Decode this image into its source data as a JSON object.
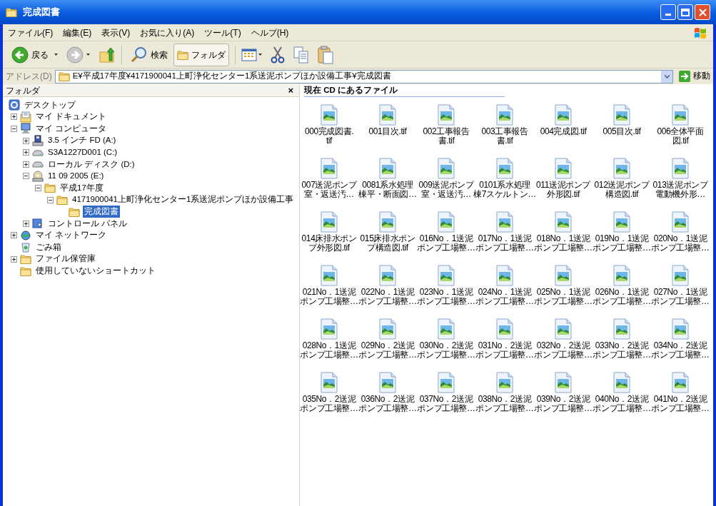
{
  "window": {
    "title": "完成図書"
  },
  "menu": [
    "ファイル(F)",
    "編集(E)",
    "表示(V)",
    "お気に入り(A)",
    "ツール(T)",
    "ヘルプ(H)"
  ],
  "toolbar": {
    "back": "戻る",
    "search": "検索",
    "folders": {
      "label": "フォルダ",
      "selected": true
    }
  },
  "address": {
    "label": "アドレス(D)",
    "value": "E¥平成17年度¥4171900041上町浄化センター1系送泥ポンプほか設備工事¥完成図書",
    "go": "移動"
  },
  "folder_pane": {
    "title": "フォルダ",
    "close": "×",
    "tree": [
      {
        "label": "デスクトップ",
        "kind": "desktop",
        "selected": false,
        "children": [
          {
            "label": "マイ ドキュメント",
            "kind": "documents",
            "expanded": false,
            "selected": false
          },
          {
            "label": "マイ コンピュータ",
            "kind": "computer",
            "expanded": true,
            "selected": false,
            "children": [
              {
                "label": "3.5 インチ FD (A:)",
                "kind": "floppy",
                "expanded": false,
                "selected": false
              },
              {
                "label": "S3A1227D001 (C:)",
                "kind": "drive",
                "expanded": false,
                "selected": false
              },
              {
                "label": "ローカル ディスク (D:)",
                "kind": "drive",
                "expanded": false,
                "selected": false
              },
              {
                "label": "11 09 2005 (E:)",
                "kind": "cd",
                "expanded": true,
                "selected": false,
                "children": [
                  {
                    "label": "平成17年度",
                    "kind": "folder",
                    "expanded": true,
                    "selected": false,
                    "children": [
                      {
                        "label": "4171900041上町浄化センター1系送泥ポンプほか設備工事",
                        "kind": "folder",
                        "expanded": true,
                        "selected": false,
                        "children": [
                          {
                            "label": "完成図書",
                            "kind": "folder",
                            "selected": true
                          }
                        ]
                      }
                    ]
                  }
                ]
              },
              {
                "label": "コントロール パネル",
                "kind": "control-panel",
                "expanded": false,
                "selected": false
              }
            ]
          },
          {
            "label": "マイ ネットワーク",
            "kind": "network",
            "expanded": false,
            "selected": false
          },
          {
            "label": "ごみ箱",
            "kind": "recycle-bin",
            "selected": false
          },
          {
            "label": "ファイル保管庫",
            "kind": "folder",
            "expanded": false,
            "selected": false
          },
          {
            "label": "使用していないショートカット",
            "kind": "folder",
            "selected": false
          }
        ]
      }
    ]
  },
  "file_pane": {
    "heading": "現在 CD にあるファイル",
    "files": [
      {
        "lines": [
          "000完成図書.",
          "tif"
        ]
      },
      {
        "lines": [
          "001目次.tif"
        ]
      },
      {
        "lines": [
          "002工事報告",
          "書.tif"
        ]
      },
      {
        "lines": [
          "003工事報告",
          "書.tif"
        ]
      },
      {
        "lines": [
          "004完成図.tif"
        ]
      },
      {
        "lines": [
          "005目次.tif"
        ]
      },
      {
        "lines": [
          "006全体平面",
          "図.tif"
        ]
      },
      {
        "lines": [
          "007送泥ポンプ",
          "室・返送汚…"
        ]
      },
      {
        "lines": [
          "0081系水処理",
          "棟平・断面図…"
        ]
      },
      {
        "lines": [
          "009送泥ポンプ",
          "室・返送汚…"
        ]
      },
      {
        "lines": [
          "0101系水処理",
          "棟7スケルトン…"
        ]
      },
      {
        "lines": [
          "011送泥ポンプ",
          "外形図.tif"
        ]
      },
      {
        "lines": [
          "012送泥ポンプ",
          "構造図.tif"
        ]
      },
      {
        "lines": [
          "013送泥ポンプ",
          "電動機外形…"
        ]
      },
      {
        "lines": [
          "014床排水ポン",
          "プ外形図.tif"
        ]
      },
      {
        "lines": [
          "015床排水ポン",
          "プ構造図.tif"
        ]
      },
      {
        "lines": [
          "016No．1送泥",
          "ポンプ工場整…"
        ]
      },
      {
        "lines": [
          "017No．1送泥",
          "ポンプ工場整…"
        ]
      },
      {
        "lines": [
          "018No．1送泥",
          "ポンプ工場整…"
        ]
      },
      {
        "lines": [
          "019No．1送泥",
          "ポンプ工場整…"
        ]
      },
      {
        "lines": [
          "020No．1送泥",
          "ポンプ工場整…"
        ]
      },
      {
        "lines": [
          "021No．1送泥",
          "ポンプ工場整…"
        ]
      },
      {
        "lines": [
          "022No．1送泥",
          "ポンプ工場整…"
        ]
      },
      {
        "lines": [
          "023No．1送泥",
          "ポンプ工場整…"
        ]
      },
      {
        "lines": [
          "024No．1送泥",
          "ポンプ工場整…"
        ]
      },
      {
        "lines": [
          "025No．1送泥",
          "ポンプ工場整…"
        ]
      },
      {
        "lines": [
          "026No．1送泥",
          "ポンプ工場整…"
        ]
      },
      {
        "lines": [
          "027No．1送泥",
          "ポンプ工場整…"
        ]
      },
      {
        "lines": [
          "028No．1送泥",
          "ポンプ工場整…"
        ]
      },
      {
        "lines": [
          "029No．2送泥",
          "ポンプ工場整…"
        ]
      },
      {
        "lines": [
          "030No．2送泥",
          "ポンプ工場整…"
        ]
      },
      {
        "lines": [
          "031No．2送泥",
          "ポンプ工場整…"
        ]
      },
      {
        "lines": [
          "032No．2送泥",
          "ポンプ工場整…"
        ]
      },
      {
        "lines": [
          "033No．2送泥",
          "ポンプ工場整…"
        ]
      },
      {
        "lines": [
          "034No．2送泥",
          "ポンプ工場整…"
        ]
      },
      {
        "lines": [
          "035No．2送泥",
          "ポンプ工場整…"
        ]
      },
      {
        "lines": [
          "036No．2送泥",
          "ポンプ工場整…"
        ]
      },
      {
        "lines": [
          "037No．2送泥",
          "ポンプ工場整…"
        ]
      },
      {
        "lines": [
          "038No．2送泥",
          "ポンプ工場整…"
        ]
      },
      {
        "lines": [
          "039No．2送泥",
          "ポンプ工場整…"
        ]
      },
      {
        "lines": [
          "040No．2送泥",
          "ポンプ工場整…"
        ]
      },
      {
        "lines": [
          "041No．2送泥",
          "ポンプ工場整…"
        ]
      }
    ]
  }
}
